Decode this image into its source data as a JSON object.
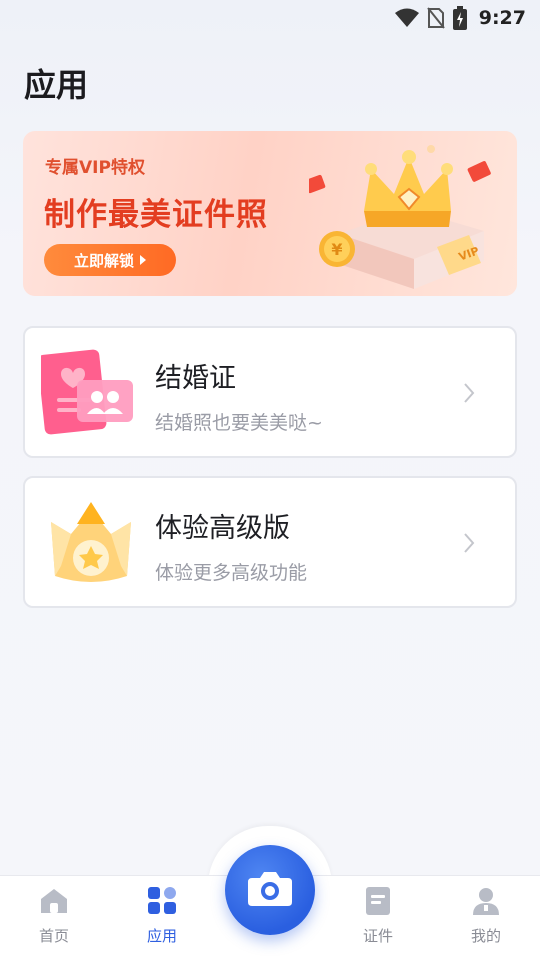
{
  "status": {
    "time": "9:27"
  },
  "page": {
    "title": "应用"
  },
  "banner": {
    "subtitle": "专属VIP特权",
    "title": "制作最美证件照",
    "button_label": "立即解锁",
    "art_text": "VIP",
    "coin_text": "¥"
  },
  "cards": [
    {
      "title": "结婚证",
      "description": "结婚照也要美美哒~",
      "icon": "marriage-certificate-icon"
    },
    {
      "title": "体验高级版",
      "description": "体验更多高级功能",
      "icon": "crown-star-icon"
    }
  ],
  "tabs": [
    {
      "label": "首页",
      "icon": "home-icon",
      "active": false
    },
    {
      "label": "应用",
      "icon": "apps-grid-icon",
      "active": true
    },
    {
      "label": "证件",
      "icon": "document-icon",
      "active": false
    },
    {
      "label": "我的",
      "icon": "user-icon",
      "active": false
    }
  ],
  "colors": {
    "accent": "#2f5fe0",
    "banner_red": "#e33d20",
    "banner_button": "#ff7a2e"
  }
}
